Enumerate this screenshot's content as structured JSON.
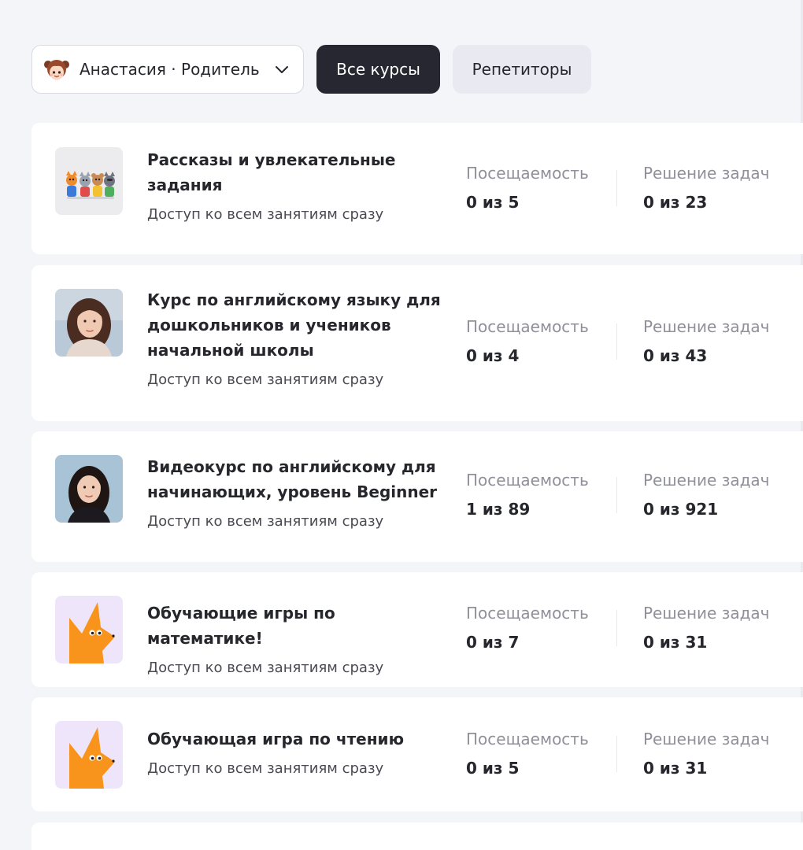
{
  "profile": {
    "name": "Анастасия · Родитель",
    "avatar_icon": "girl-avatar-icon",
    "dropdown_icon": "chevron-down-icon"
  },
  "tabs": {
    "all_courses": "Все курсы",
    "tutors": "Репетиторы"
  },
  "colors": {
    "background": "#f4f5f9",
    "card": "#ffffff",
    "active_tab": "#262730",
    "inactive_tab": "#e8e9f1",
    "muted_text": "#8f909a",
    "fox_orange": "#f8941c",
    "fox_background": "#efe5fb"
  },
  "courses": [
    {
      "title": "Рассказы и увлекательные задания",
      "subtitle": "Доступ ко всем занятиям сразу",
      "thumb": "cartoon-animals-thumbnail",
      "attendance_label": "Посещаемость",
      "attendance_value": "0 из 5",
      "tasks_label": "Решение задач",
      "tasks_value": "0 из 23"
    },
    {
      "title": "Курс по английскому языку для дошкольников и учеников начальной школы",
      "subtitle": "Доступ ко всем занятиям сразу",
      "thumb": "teacher-photo-thumbnail",
      "attendance_label": "Посещаемость",
      "attendance_value": "0 из 4",
      "tasks_label": "Решение задач",
      "tasks_value": "0 из 43"
    },
    {
      "title": "Видеокурс по английскому для начинающих, уровень Beginner",
      "subtitle": "Доступ ко всем занятиям сразу",
      "thumb": "teacher-photo-thumbnail",
      "attendance_label": "Посещаемость",
      "attendance_value": "1 из 89",
      "tasks_label": "Решение задач",
      "tasks_value": "0 из 921"
    },
    {
      "title": "Обучающие игры по математике!",
      "subtitle": "Доступ ко всем занятиям сразу",
      "thumb": "fox-thumbnail",
      "attendance_label": "Посещаемость",
      "attendance_value": "0 из 7",
      "tasks_label": "Решение задач",
      "tasks_value": "0 из 31"
    },
    {
      "title": "Обучающая игра по чтению",
      "subtitle": "Доступ ко всем занятиям сразу",
      "thumb": "fox-thumbnail",
      "attendance_label": "Посещаемость",
      "attendance_value": "0 из 5",
      "tasks_label": "Решение задач",
      "tasks_value": "0 из 31"
    }
  ]
}
